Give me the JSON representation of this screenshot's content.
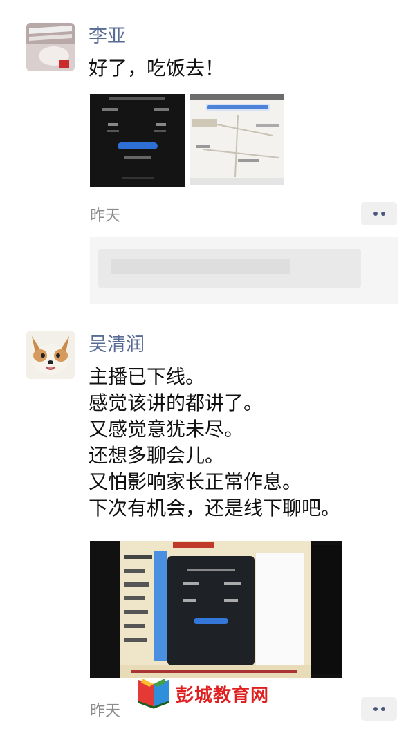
{
  "posts": [
    {
      "author": "李亚",
      "text_lines": [
        "好了，吃饭去！"
      ],
      "time": "昨天",
      "avatar_icon": "profile-photo-icon",
      "image_count": 2
    },
    {
      "author": "吴清润",
      "text_lines": [
        "主播已下线。",
        "感觉该讲的都讲了。",
        "又感觉意犹未尽。",
        "还想多聊会儿。",
        "又怕影响家长正常作息。",
        "下次有机会，还是线下聊吧。"
      ],
      "time": "昨天",
      "avatar_icon": "corgi-dog-icon",
      "image_count": 1
    }
  ],
  "watermark": {
    "text": "彭城教育网",
    "icon": "books-logo-icon"
  },
  "colors": {
    "author_name": "#576b95",
    "body_text": "#111111",
    "meta_text": "#8c8c8c",
    "watermark": "#e02020",
    "more_dots": "#4a5a7c"
  }
}
